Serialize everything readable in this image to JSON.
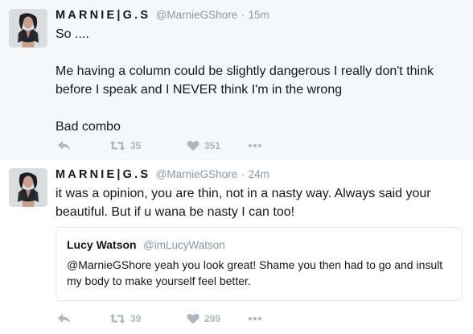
{
  "tweets": [
    {
      "display_name": "MARNIE|G.S",
      "handle": "@MarnieGShore",
      "separator": "·",
      "time": "15m",
      "text": "So ....\n\nMe having a column could be slightly dangerous I really don't think before I speak and I NEVER think I'm in the wrong\n\nBad combo",
      "retweets": "35",
      "likes": "351"
    },
    {
      "display_name": "MARNIE|G.S",
      "handle": "@MarnieGShore",
      "separator": "·",
      "time": "24m",
      "text": "it was a opinion, you are thin, not in a nasty way. Always said your beautiful. But if u wana be nasty I can too!",
      "quote": {
        "name": "Lucy Watson",
        "handle": "@imLucyWatson",
        "text": "@MarnieGShore yeah you look great! Shame you then had to go and insult my body to make yourself feel better."
      },
      "retweets": "39",
      "likes": "299"
    }
  ],
  "icons": {
    "reply": "reply-icon",
    "retweet": "retweet-icon",
    "like": "heart-icon",
    "more": "more-dots-icon"
  },
  "colors": {
    "background_highlight": "#f5f8fa",
    "text": "#14171a",
    "muted": "#8899a6",
    "icon": "#aab8c2",
    "border": "#e1e8ed"
  }
}
